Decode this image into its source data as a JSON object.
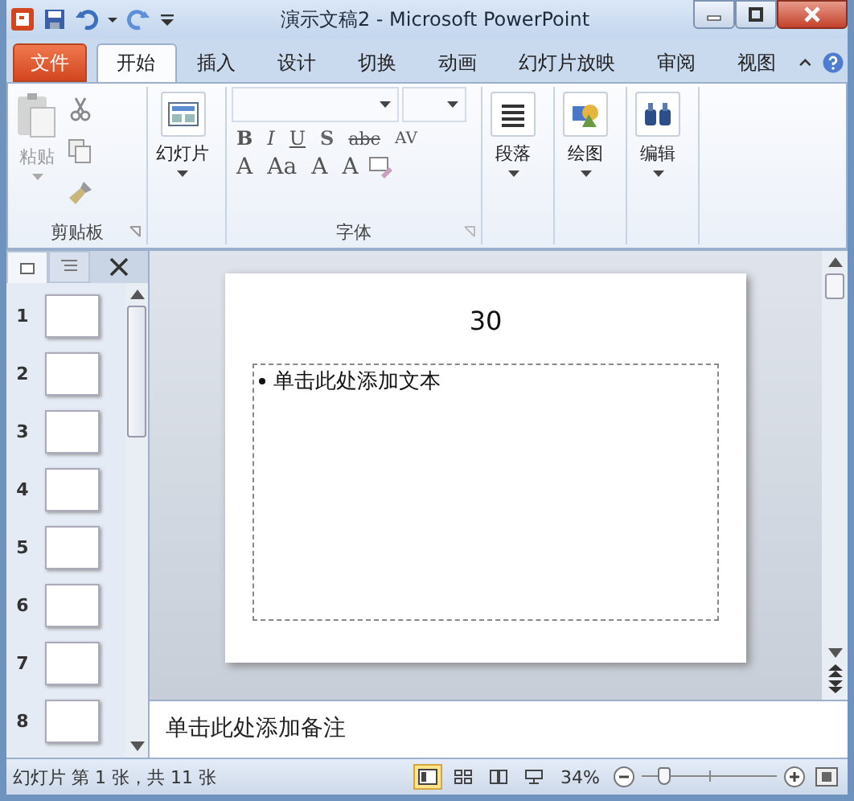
{
  "window": {
    "title": "演示文稿2 - Microsoft PowerPoint"
  },
  "file_tab": "文件",
  "tabs": [
    {
      "label": "开始",
      "selected": true
    },
    {
      "label": "插入",
      "selected": false
    },
    {
      "label": "设计",
      "selected": false
    },
    {
      "label": "切换",
      "selected": false
    },
    {
      "label": "动画",
      "selected": false
    },
    {
      "label": "幻灯片放映",
      "selected": false
    },
    {
      "label": "审阅",
      "selected": false
    },
    {
      "label": "视图",
      "selected": false
    }
  ],
  "ribbon": {
    "clipboard": {
      "label": "剪贴板",
      "paste": {
        "label": "粘贴",
        "disabled": true
      }
    },
    "slides_button": "幻灯片",
    "font": {
      "label": "字体",
      "row1": [
        "B",
        "I",
        "U",
        "S",
        "abc",
        "AV"
      ],
      "row2": [
        "A",
        "Aa",
        "A",
        "A"
      ]
    },
    "big_buttons": [
      {
        "kind": "paragraph",
        "label": "段落"
      },
      {
        "kind": "drawing",
        "label": "绘图"
      },
      {
        "kind": "editing",
        "label": "编辑"
      }
    ]
  },
  "thumbnails": [
    "1",
    "2",
    "3",
    "4",
    "5",
    "6",
    "7",
    "8"
  ],
  "slide": {
    "title": "30",
    "body": "单击此处添加文本"
  },
  "notes": {
    "placeholder": "单击此处添加备注"
  },
  "status_bar": {
    "slide_info": "幻灯片 第 1 张，共 11 张",
    "view_buttons": [
      {
        "kind": "normal",
        "selected": true
      },
      {
        "kind": "sorter",
        "selected": false
      },
      {
        "kind": "reading",
        "selected": false
      },
      {
        "kind": "slideshow",
        "selected": false
      }
    ],
    "zoom": "34%",
    "level": 0.17
  }
}
